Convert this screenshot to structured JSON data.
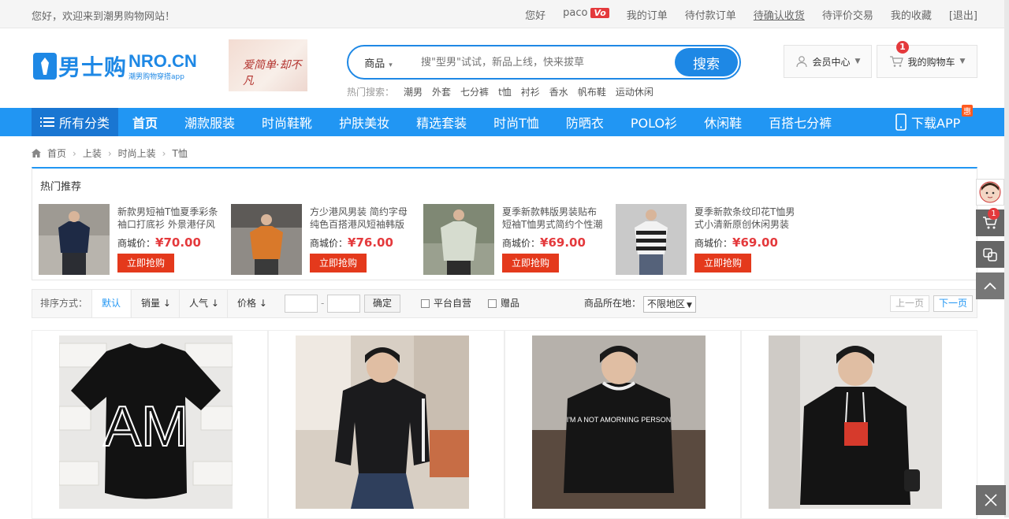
{
  "topbar": {
    "welcome": "您好，欢迎来到潮男购物网站！",
    "hello": "您好",
    "username": "paco",
    "vip_badge": "Vo",
    "my_orders": "我的订单",
    "pending_payment": "待付款订单",
    "pending_receipt": "待确认收货",
    "pending_review": "待评价交易",
    "favorites": "我的收藏",
    "logout": "[退出]"
  },
  "logo": {
    "cn": "男士购",
    "en": "NRO.CN",
    "slogan": "潮男购物穿搭app"
  },
  "promo": {
    "text": "爱简单·却不凡"
  },
  "search": {
    "category": "商品",
    "placeholder": "搜\"型男\"试试，新品上线，快来拔草",
    "button": "搜索",
    "hot_label": "热门搜索：",
    "hot_terms": [
      "潮男",
      "外套",
      "七分裤",
      "t恤",
      "衬衫",
      "香水",
      "帆布鞋",
      "运动休闲"
    ]
  },
  "member": {
    "label": "会员中心"
  },
  "cart": {
    "label": "我的购物车",
    "count": "1"
  },
  "nav": {
    "all_categories": "所有分类",
    "items": [
      "首页",
      "潮款服装",
      "时尚鞋靴",
      "护肤美妆",
      "精选套装",
      "时尚T恤",
      "防晒衣",
      "POLO衫",
      "休闲鞋",
      "百搭七分裤"
    ],
    "download_app": "下载APP",
    "hui": "惠"
  },
  "breadcrumb": [
    "首页",
    "上装",
    "时尚上装",
    "T恤"
  ],
  "recommend": {
    "title": "热门推荐",
    "price_label": "商城价：",
    "buy_label": "立即抢购",
    "items": [
      {
        "name": "新款男短袖T恤夏季彩条袖口打底衫 外景港仔风",
        "price": "¥70.00"
      },
      {
        "name": "方少港风男装 简约字母纯色百搭港风短袖韩版",
        "price": "¥76.00"
      },
      {
        "name": "夏季新款韩版男装贴布短袖T恤男式简约个性潮",
        "price": "¥69.00"
      },
      {
        "name": "夏季新款条纹印花T恤男式小清新原创休闲男装",
        "price": "¥69.00"
      }
    ]
  },
  "sort": {
    "label": "排序方式：",
    "default": "默认",
    "sales": "销量",
    "popularity": "人气",
    "price": "价格",
    "price_from": "",
    "price_to": "",
    "confirm": "确定",
    "self_operated": "平台自营",
    "gift": "赠品",
    "location_label": "商品所在地：",
    "location_value": "不限地区",
    "prev": "上一页",
    "next": "下一页"
  },
  "products": [
    {
      "print": "AM"
    },
    {
      "print": ""
    },
    {
      "print": "I'M A NOT AMORNING PERSON"
    },
    {
      "print": ""
    }
  ],
  "colors": {
    "accent": "#2196f3",
    "price_red": "#e4393c",
    "buy_red": "#e4391c"
  }
}
